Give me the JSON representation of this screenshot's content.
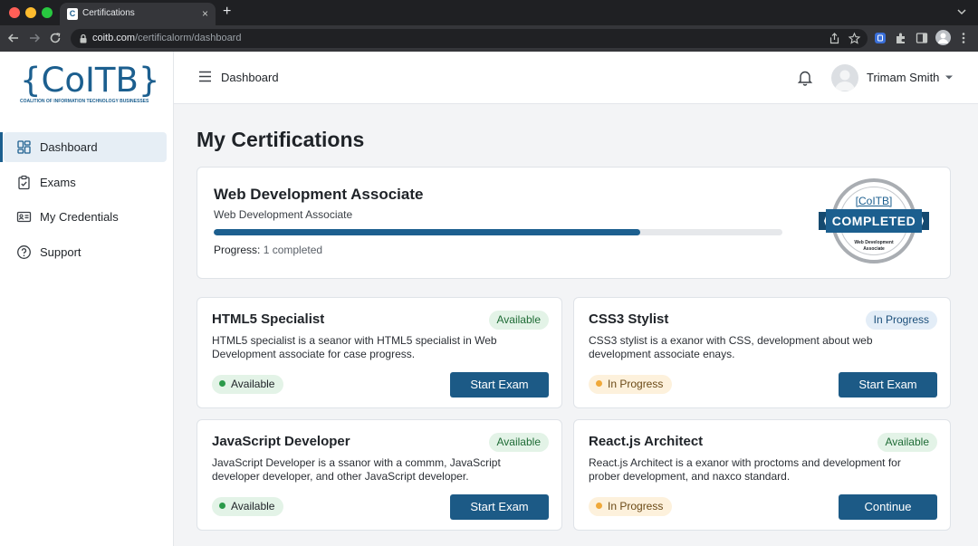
{
  "browser": {
    "tab_title": "Certifications",
    "tab_favicon_letter": "C",
    "tab_close": "×",
    "new_tab": "+",
    "url_host": "coitb.com",
    "url_path": "/certificalorm/dashboard"
  },
  "brand": {
    "logo": "{CoITB}",
    "tagline": "COALITION OF INFORMATION TECHNOLOGY BUSINESSES",
    "color": "#1c5f8f"
  },
  "sidebar": {
    "items": [
      {
        "label": "Dashboard",
        "icon": "dashboard-grid-icon",
        "active": true
      },
      {
        "label": "Exams",
        "icon": "clipboard-icon",
        "active": false
      },
      {
        "label": "My Credentials",
        "icon": "id-card-icon",
        "active": false
      },
      {
        "label": "Support",
        "icon": "help-circle-icon",
        "active": false
      }
    ]
  },
  "topbar": {
    "title": "Dashboard",
    "user_name": "Trimam Smith"
  },
  "page": {
    "title": "My Certifications"
  },
  "featured": {
    "title": "Web Development Associate",
    "subtitle": "Web Development Associate",
    "progress_label": "Progress:",
    "progress_value": "1 completed",
    "progress_fraction": 0.75,
    "seal": {
      "logo": "[CoITB]",
      "label": "COMPLETED",
      "caption": "Web Development Associate"
    }
  },
  "certs": [
    {
      "title": "HTML5 Specialist",
      "tag": "Available",
      "description": "HTML5 specialist is a seanor with HTML5 specialist in Web Development associate for case progress.",
      "status": "Available",
      "action": "Start Exam"
    },
    {
      "title": "CSS3 Stylist",
      "tag": "In Progress",
      "description": "CSS3 stylist is a exanor with CSS, development about web development associate enays.",
      "status": "In Progress",
      "action": "Start Exam"
    },
    {
      "title": "JavaScript Developer",
      "tag": "Available",
      "description": "JavaScript Developer is a ssanor with a commm, JavaScript developer developer, and other JavaScript developer.",
      "status": "Available",
      "action": "Start Exam"
    },
    {
      "title": "React.js Architect",
      "tag": "Available",
      "description": "React.js Architect is a exanor with proctoms and development for prober development, and naxco standard.",
      "status": "In Progress",
      "action": "Continue"
    }
  ]
}
